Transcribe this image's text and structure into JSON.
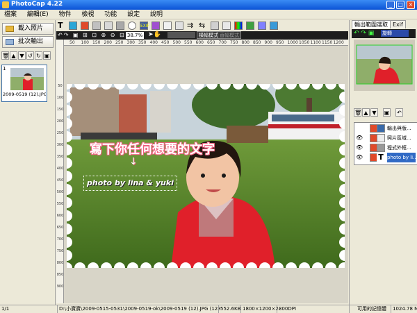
{
  "window": {
    "title": "PhotoCap 4.22"
  },
  "menu": [
    "檔案",
    "編輯(E)",
    "物件",
    "檢視",
    "功能",
    "設定",
    "說明"
  ],
  "left_panel": {
    "load_button": "載入照片",
    "batch_button": "批次輸出",
    "thumbnail_label": "2009-0519 (12).JPG",
    "thumbnail_index": "1"
  },
  "toolbar": {
    "zoom": "38.7%",
    "mode_a": "橫幅模式",
    "mode_b": "直幅模式"
  },
  "canvas": {
    "headline": "寫下你任何想要的文字",
    "photo_text": "photo by lina & yuki",
    "ruler_top": [
      "50",
      "100",
      "150",
      "200",
      "250",
      "300",
      "350",
      "400",
      "450",
      "500",
      "550",
      "600",
      "650",
      "700",
      "750",
      "800",
      "850",
      "900",
      "950",
      "1000",
      "1050",
      "1100",
      "1150",
      "1200"
    ],
    "ruler_left": [
      "50",
      "100",
      "150",
      "200",
      "250",
      "300",
      "350",
      "400",
      "450",
      "500",
      "550",
      "600",
      "650",
      "700",
      "750",
      "800",
      "850",
      "900"
    ]
  },
  "right_panel": {
    "tab_output": "輸出範圍選取",
    "tab_exif": "Exif",
    "rotate_label": "旋轉",
    "layers": [
      {
        "label": "輸出與版..."
      },
      {
        "label": "照片區域..."
      },
      {
        "label": "程式外框..."
      },
      {
        "label": "photo by li..."
      }
    ]
  },
  "status": {
    "page": "1/1",
    "path": "D:\\小寶寶\\2009-0515-0531\\2009-0519-ok\\2009-0519 (12).JPG (1280×960×24)",
    "filesize": "552.6KB",
    "dims": "1800×1200×24b",
    "dpi": "300DPI",
    "memory_label": "可用的記憶體",
    "memory_value": "1024.78 M"
  },
  "colors": {
    "titlebar": "#0b53d6",
    "accent_selected": "#316ac5",
    "dress_red": "#e0202a"
  }
}
